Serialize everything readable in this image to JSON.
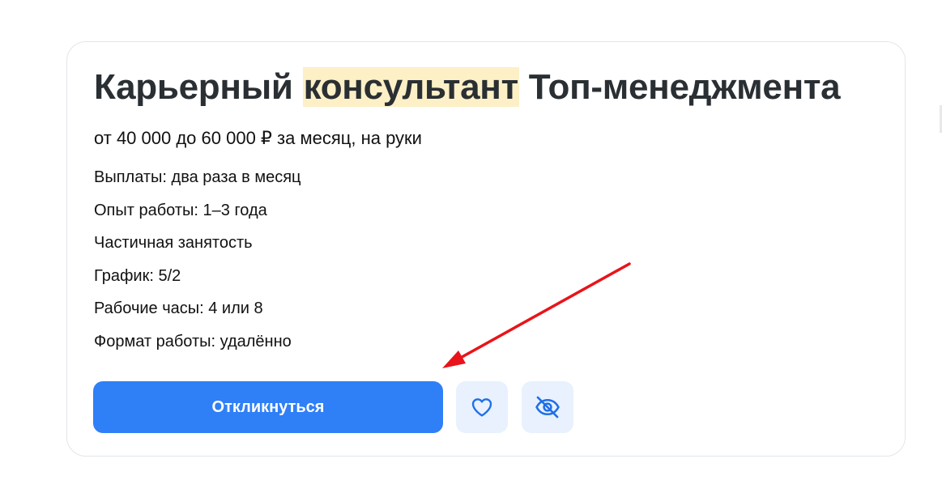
{
  "vacancy": {
    "title_before": "Карьерный",
    "title_highlight": "консультант",
    "title_after": "Топ-менеджмента",
    "salary": "от 40 000 до 60 000 ₽ за месяц, на руки",
    "details": [
      "Выплаты: два раза в месяц",
      "Опыт работы: 1–3 года",
      "Частичная занятость",
      "График: 5/2",
      "Рабочие часы: 4 или 8",
      "Формат работы: удалённо"
    ],
    "respond_label": "Откликнуться",
    "favorite_icon": "heart-icon",
    "hide_icon": "eye-off-icon"
  },
  "colors": {
    "accent": "#2f7ff7",
    "icon_button_bg": "#e8f1fd",
    "highlight": "#fdf0c6",
    "annotation_arrow": "#e8141a"
  }
}
